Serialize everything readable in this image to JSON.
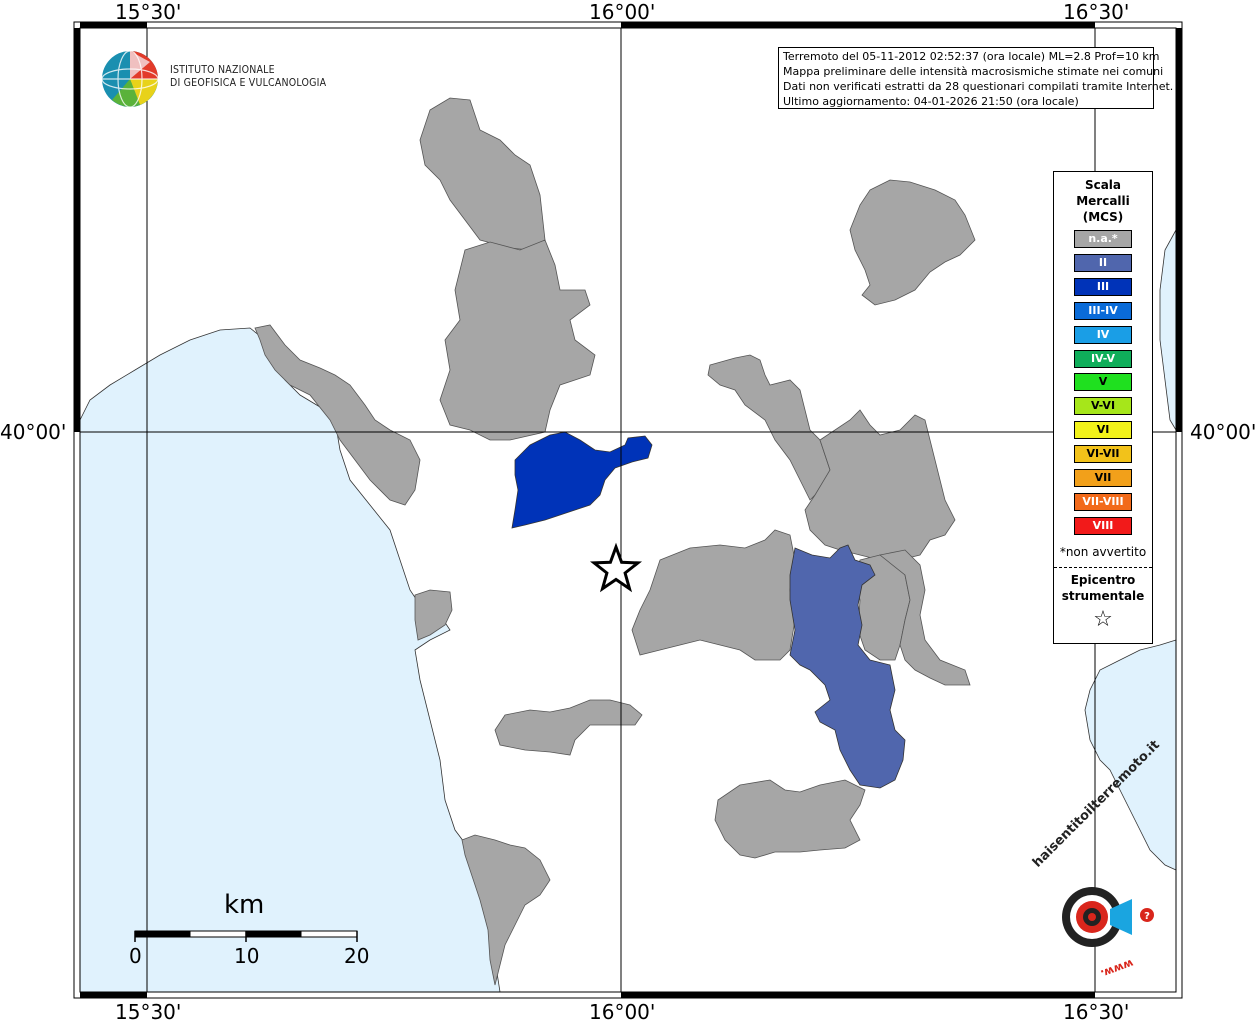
{
  "title": "",
  "coordinates": {
    "top_left": "15°30'",
    "top_center": "16°00'",
    "top_right": "16°30'",
    "bottom_left": "15°30'",
    "bottom_center": "16°00'",
    "bottom_right": "16°30'",
    "left_mid": "40°00'",
    "right_mid": "40°00'"
  },
  "logo": {
    "line1": "ISTITUTO NAZIONALE",
    "line2": "DI GEOFISICA E VULCANOLOGIA"
  },
  "info": {
    "line1": "Terremoto del 05-11-2012 02:52:37 (ora locale) ML=2.8 Prof=10 km",
    "line2": "Mappa preliminare delle intensità macrosismiche stimate nei comuni",
    "line3": "Dati non verificati estratti da 28 questionari compilati tramite Internet.",
    "line4": "Ultimo aggiornamento: 04-01-2026 21:50 (ora locale)"
  },
  "legend": {
    "title_line1": "Scala",
    "title_line2": "Mercalli",
    "title_line3": "(MCS)",
    "items": [
      {
        "label": "n.a.*",
        "color": "#a6a6a6"
      },
      {
        "label": "II",
        "color": "#5066ad"
      },
      {
        "label": "III",
        "color": "#0033b8"
      },
      {
        "label": "III-IV",
        "color": "#0a6bd8"
      },
      {
        "label": "IV",
        "color": "#1a9ee6"
      },
      {
        "label": "IV-V",
        "color": "#0fae5a"
      },
      {
        "label": "V",
        "color": "#1fe01f"
      },
      {
        "label": "V-VI",
        "color": "#a6e61a"
      },
      {
        "label": "VI",
        "color": "#f2f21a"
      },
      {
        "label": "VI-VII",
        "color": "#f2c21a"
      },
      {
        "label": "VII",
        "color": "#f2a01a"
      },
      {
        "label": "VII-VIII",
        "color": "#f26a1a"
      },
      {
        "label": "VIII",
        "color": "#f21a1a"
      }
    ],
    "note": "*non avvertito",
    "epicenter_line1": "Epicentro",
    "epicenter_line2": "strumentale",
    "epicenter_symbol": "☆"
  },
  "scale_bar": {
    "unit": "km",
    "ticks": [
      "0",
      "10",
      "20"
    ]
  },
  "haisentito": {
    "text": "haisentitoilterremoto.it",
    "prefix": "www."
  },
  "colors": {
    "sea": "#e0f2fd",
    "municipality_na": "#a6a6a6",
    "intensity_II": "#5066ad",
    "intensity_III": "#0033b8"
  }
}
